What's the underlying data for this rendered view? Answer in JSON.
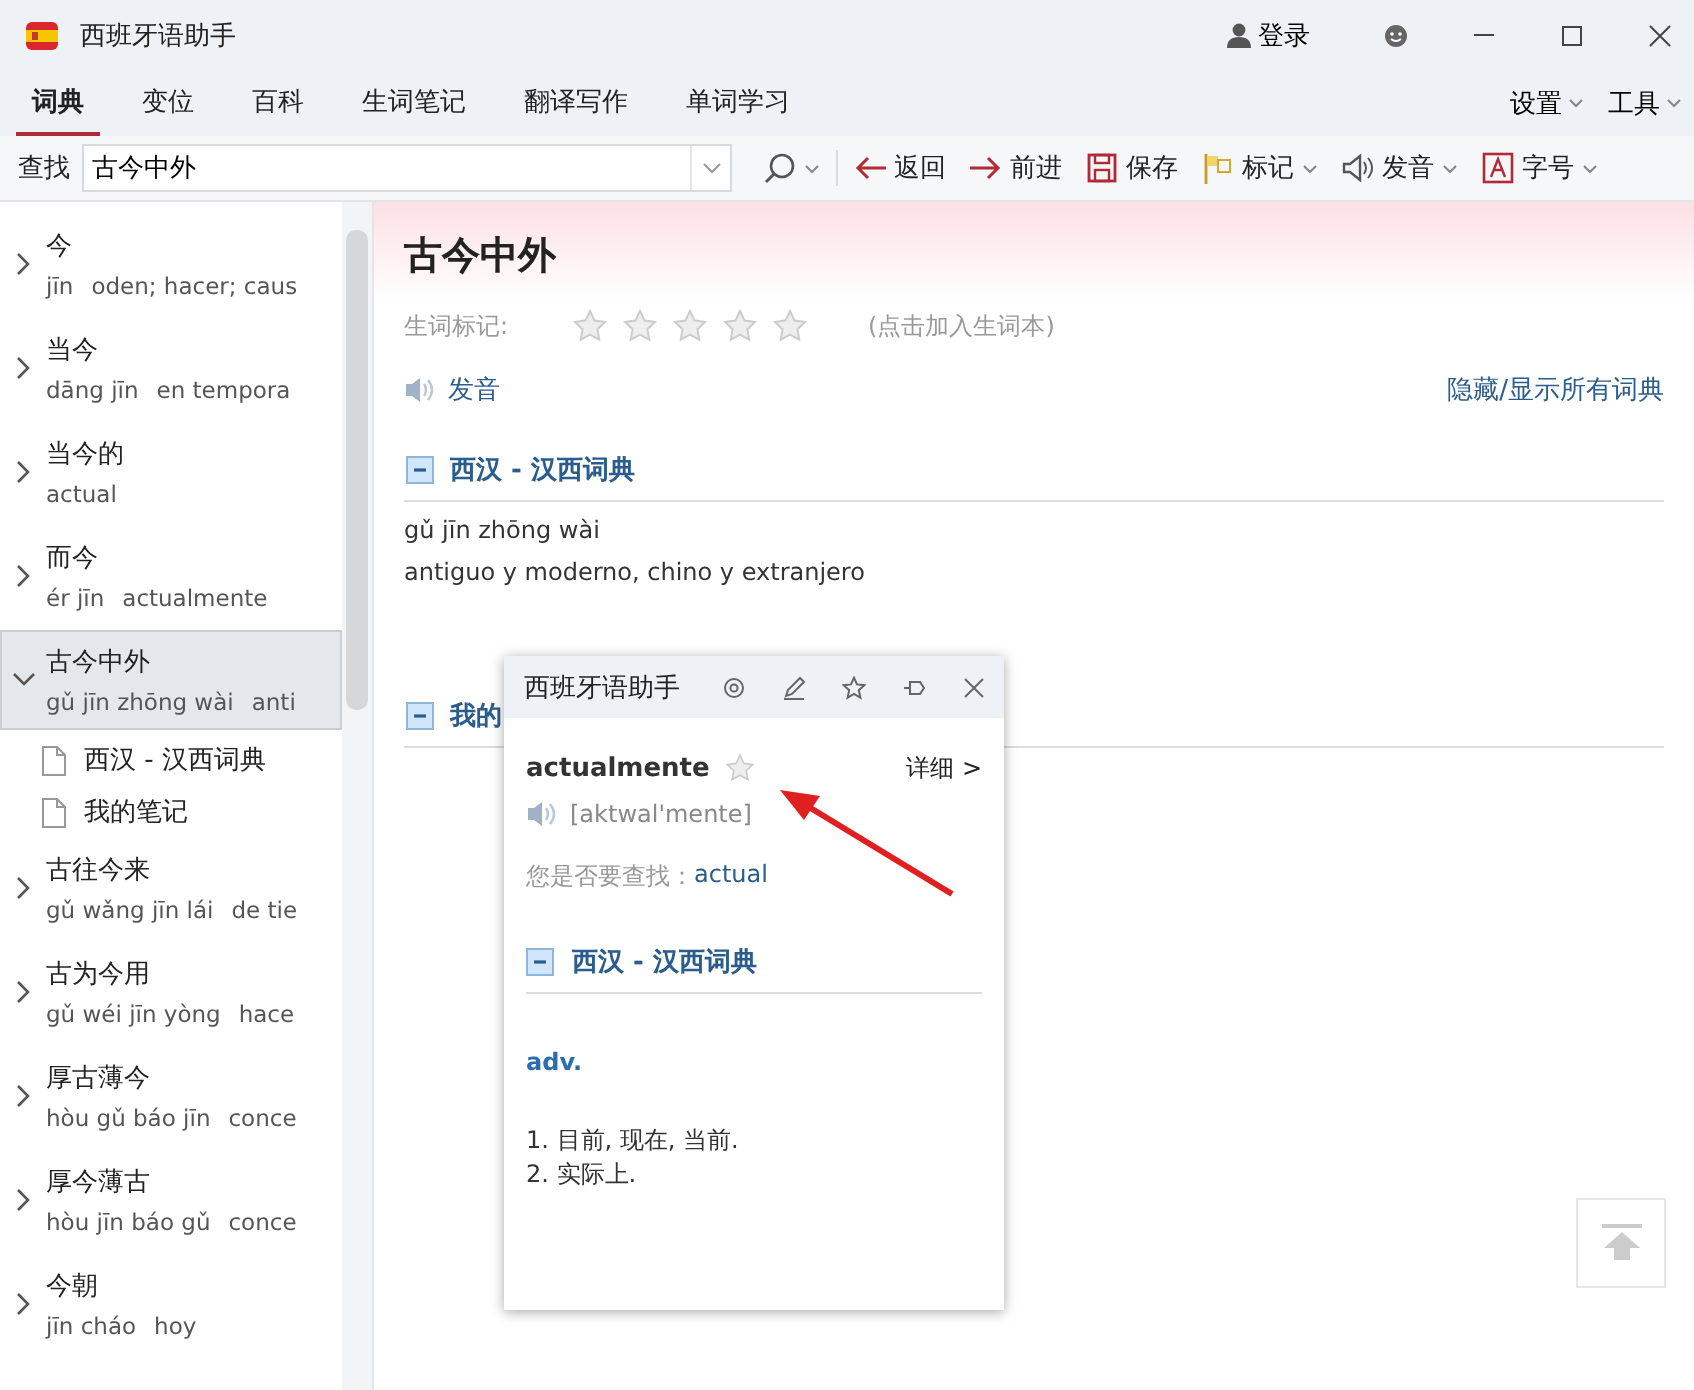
{
  "window": {
    "title": "西班牙语助手",
    "login": "登录"
  },
  "tabs": [
    {
      "label": "词典",
      "selected": true
    },
    {
      "label": "变位",
      "selected": false
    },
    {
      "label": "百科",
      "selected": false
    },
    {
      "label": "生词笔记",
      "selected": false
    },
    {
      "label": "翻译写作",
      "selected": false
    },
    {
      "label": "单词学习",
      "selected": false
    }
  ],
  "menus": [
    "设置",
    "工具"
  ],
  "toolbar": {
    "search_label": "查找",
    "search_value": "古今中外",
    "buttons": [
      {
        "kind": "back",
        "label": "返回",
        "has_menu": false
      },
      {
        "kind": "forward",
        "label": "前进",
        "has_menu": false
      },
      {
        "kind": "save",
        "label": "保存",
        "has_menu": false
      },
      {
        "kind": "mark",
        "label": "标记",
        "has_menu": true
      },
      {
        "kind": "sound",
        "label": "发音",
        "has_menu": true
      },
      {
        "kind": "font",
        "label": "字号",
        "has_menu": true
      }
    ]
  },
  "sidebar": {
    "items": [
      {
        "word": "今",
        "pinyin": "jīn",
        "meaning": "oden; hacer; caus",
        "expanded": false,
        "selected": false
      },
      {
        "word": "当今",
        "pinyin": "dāng jīn",
        "meaning": "en tempora",
        "expanded": false,
        "selected": false
      },
      {
        "word": "当今的",
        "meaning": "actual",
        "expanded": false,
        "selected": false
      },
      {
        "word": "而今",
        "pinyin": "ér jīn",
        "meaning": "actualmente",
        "expanded": false,
        "selected": false
      },
      {
        "word": "古今中外",
        "pinyin": "gǔ jīn zhōng wài",
        "meaning": "anti",
        "expanded": true,
        "selected": true,
        "children": [
          {
            "label": "西汉 - 汉西词典"
          },
          {
            "label": "我的笔记"
          }
        ]
      },
      {
        "word": "古往今来",
        "pinyin": "gǔ wǎng jīn lái",
        "meaning": "de tie",
        "expanded": false,
        "selected": false
      },
      {
        "word": "古为今用",
        "pinyin": "gǔ wéi jīn yòng",
        "meaning": "hace",
        "expanded": false,
        "selected": false
      },
      {
        "word": "厚古薄今",
        "pinyin": "hòu gǔ báo jīn",
        "meaning": "conce",
        "expanded": false,
        "selected": false
      },
      {
        "word": "厚今薄古",
        "pinyin": "hòu jīn báo gǔ",
        "meaning": "conce",
        "expanded": false,
        "selected": false
      },
      {
        "word": "今朝",
        "pinyin": "jīn cháo",
        "meaning": "hoy",
        "expanded": false,
        "selected": false
      }
    ]
  },
  "entry": {
    "headword": "古今中外",
    "rating": {
      "label": "生词标记:",
      "stars": 0,
      "hint": "(点击加入生词本)"
    },
    "pronounce": "发音",
    "toggle_all": "隐藏/显示所有词典",
    "sections": [
      {
        "title": "西汉 - 汉西词典",
        "expanded": true,
        "lines": [
          "gǔ jīn zhōng wài",
          "antiguo y moderno, chino y extranjero"
        ]
      },
      {
        "title": "我的",
        "expanded": true
      }
    ]
  },
  "popup": {
    "title": "西班牙语助手",
    "word": "actualmente",
    "starred": false,
    "detail": "详细 >",
    "phonetic": "[aktwal'mente]",
    "suggest_label": "您是否要查找：",
    "suggest": "actual",
    "section": {
      "title": "西汉 - 汉西词典",
      "expanded": true
    },
    "pos": "adv.",
    "senses": [
      "1. 目前, 现在, 当前.",
      "2. 实际上."
    ]
  }
}
